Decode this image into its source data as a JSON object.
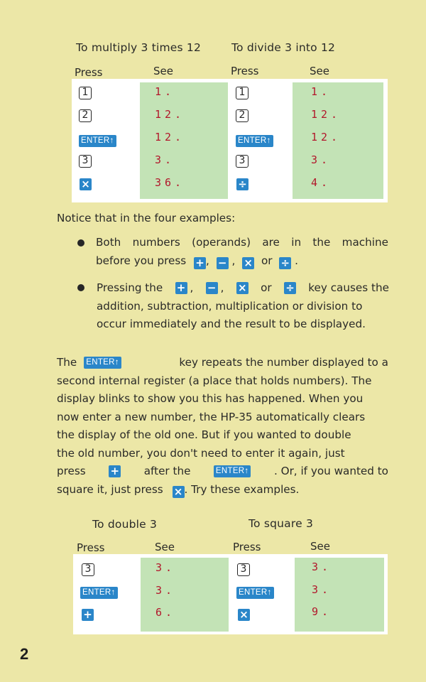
{
  "example1": {
    "title_multiply": "To multiply 3 times 12",
    "title_divide": "To divide 3 into 12",
    "press_label": "Press",
    "see_label": "See",
    "multiply_keys": [
      "1",
      "2",
      "ENTER↑",
      "3",
      "×"
    ],
    "multiply_display": [
      "1.",
      "12.",
      "12.",
      "3.",
      "36."
    ],
    "divide_keys": [
      "1",
      "2",
      "ENTER↑",
      "3",
      "÷"
    ],
    "divide_display": [
      "1.",
      "12.",
      "12.",
      "3.",
      "4."
    ]
  },
  "notice": {
    "intro": "Notice that in the four examples:",
    "bullet1_line1": [
      "Both",
      "numbers",
      "(operands)",
      "are",
      "in",
      "the",
      "machine"
    ],
    "bullet1_line2_start": "before you press",
    "bullet1_sep": ",",
    "bullet1_or": "or",
    "bullet1_end": ".",
    "bullet2_start": "Pressing the",
    "bullet2_or": "or",
    "bullet2_end": "key causes the",
    "bullet2_line2": "addition, subtraction, multiplication or division to",
    "bullet2_line3": "occur immediately and the result to be displayed."
  },
  "enter_paragraph": {
    "the": "The",
    "line1_rest": "key repeats the number displayed to a",
    "line2": "second internal register (a place that holds numbers). The",
    "line3": "display blinks to show you this has happened. When you",
    "line4": "now enter a new number, the HP-35 automatically clears",
    "line5": "the display of the old one. But if you wanted to double",
    "line6": "the old number, you don't need to enter it again, just",
    "press": "press",
    "after_the": "after the",
    "or_if": ". Or, if you wanted to",
    "square_it": "square it, just press",
    "try": ". Try these examples."
  },
  "example2": {
    "title_double": "To double 3",
    "title_square": "To square 3",
    "press_label": "Press",
    "see_label": "See",
    "double_keys": [
      "3",
      "ENTER↑",
      "+"
    ],
    "double_display": [
      "3.",
      "3.",
      "6."
    ],
    "square_keys": [
      "3",
      "ENTER↑",
      "×"
    ],
    "square_display": [
      "3.",
      "3.",
      "9."
    ]
  },
  "keys": {
    "plus": "+",
    "minus": "−",
    "times": "×",
    "divide": "÷",
    "enter": "ENTER↑"
  },
  "page_number": "2",
  "colors": {
    "page_bg": "#ece7a7",
    "display_bg": "#c3e3b6",
    "key_blue": "#2a86c9",
    "display_digit": "#b2172b"
  }
}
